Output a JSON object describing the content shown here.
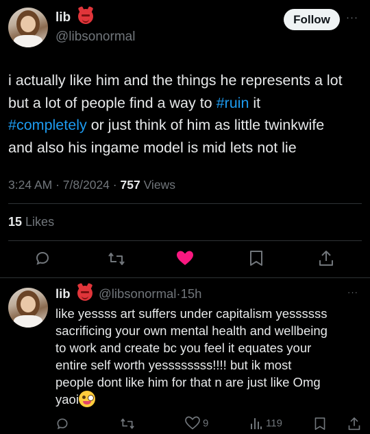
{
  "main_tweet": {
    "display_name": "lib",
    "handle": "@libsonormal",
    "follow_label": "Follow",
    "more_label": "···",
    "text_lines": [
      [
        "i actually like him and the things he represents a lot"
      ],
      [
        "but a lot of people find a way to ",
        "#ruin",
        " it"
      ],
      [
        "#completely",
        " or just think of him as little twinkwife"
      ],
      [
        "and also his ingame model is mid lets not lie"
      ]
    ],
    "time": "3:24 AM",
    "date": "7/8/2024",
    "separator": "·",
    "views_count": "757",
    "views_label": "Views",
    "likes_count": "15",
    "likes_label": "Likes"
  },
  "reply": {
    "display_name": "lib",
    "handle": "@libsonormal",
    "separator": "·",
    "age": "15h",
    "more_label": "···",
    "text_lines": [
      "like yessss art suffers under capitalism yessssss",
      "sacrificing your own mental health and wellbeing",
      "to work and create bc you feel it equates your",
      "entire self worth yessssssss!!!! but ik most",
      "people dont like him for that n are just like Omg",
      "yaoi"
    ],
    "like_count": "9",
    "views_count": "119"
  },
  "colors": {
    "background": "#000000",
    "text": "#e7e9ea",
    "muted": "#71767b",
    "link": "#1d9bf0",
    "like_active": "#f91880",
    "divider": "#2f3336"
  }
}
